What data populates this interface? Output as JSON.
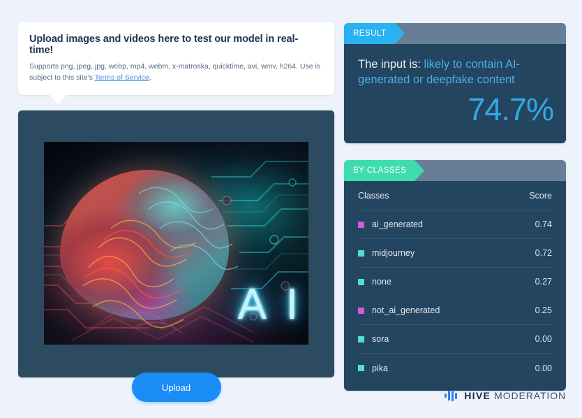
{
  "background_color": "#eef3fb",
  "upload_card": {
    "title": "Upload images and videos here to test our model in real-time!",
    "description_before": "Supports png, jpeg, jpg, webp, mp4, webm, x-matroska, quicktime, avi, wmv, h264. Use is subject to this site’s ",
    "terms_link": "Terms of Service",
    "description_after": "."
  },
  "preview": {
    "overlay_text": "A I"
  },
  "upload_button": {
    "label": "Upload",
    "color": "#1a8cf5"
  },
  "result_panel": {
    "tag": "RESULT",
    "tag_color": "#2ab2f0",
    "prefix": "The input is: ",
    "verdict": "likely to contain AI-generated or deepfake content",
    "verdict_color": "#4aaee8",
    "score": "74.7%"
  },
  "classes_panel": {
    "tag": "BY CLASSES",
    "tag_color": "#3fdcae",
    "columns": {
      "name": "Classes",
      "score": "Score"
    },
    "rows": [
      {
        "label": "ai_generated",
        "score": "0.74",
        "color": "#d756d9"
      },
      {
        "label": "midjourney",
        "score": "0.72",
        "color": "#4ee0cf"
      },
      {
        "label": "none",
        "score": "0.27",
        "color": "#4ee0cf"
      },
      {
        "label": "not_ai_generated",
        "score": "0.25",
        "color": "#d756d9"
      },
      {
        "label": "sora",
        "score": "0.00",
        "color": "#4ee0cf"
      },
      {
        "label": "pika",
        "score": "0.00",
        "color": "#4ee0cf"
      }
    ]
  },
  "logo": {
    "brand": "HIVE",
    "product": "MODERATION",
    "bar_color": "#2f7ff0",
    "bars": [
      6,
      14,
      16,
      9
    ]
  },
  "chart_data": {
    "type": "table",
    "title": "BY CLASSES",
    "categories": [
      "ai_generated",
      "midjourney",
      "none",
      "not_ai_generated",
      "sora",
      "pika"
    ],
    "values": [
      0.74,
      0.72,
      0.27,
      0.25,
      0.0,
      0.0
    ],
    "xlabel": "Classes",
    "ylabel": "Score",
    "ylim": [
      0,
      1
    ]
  }
}
